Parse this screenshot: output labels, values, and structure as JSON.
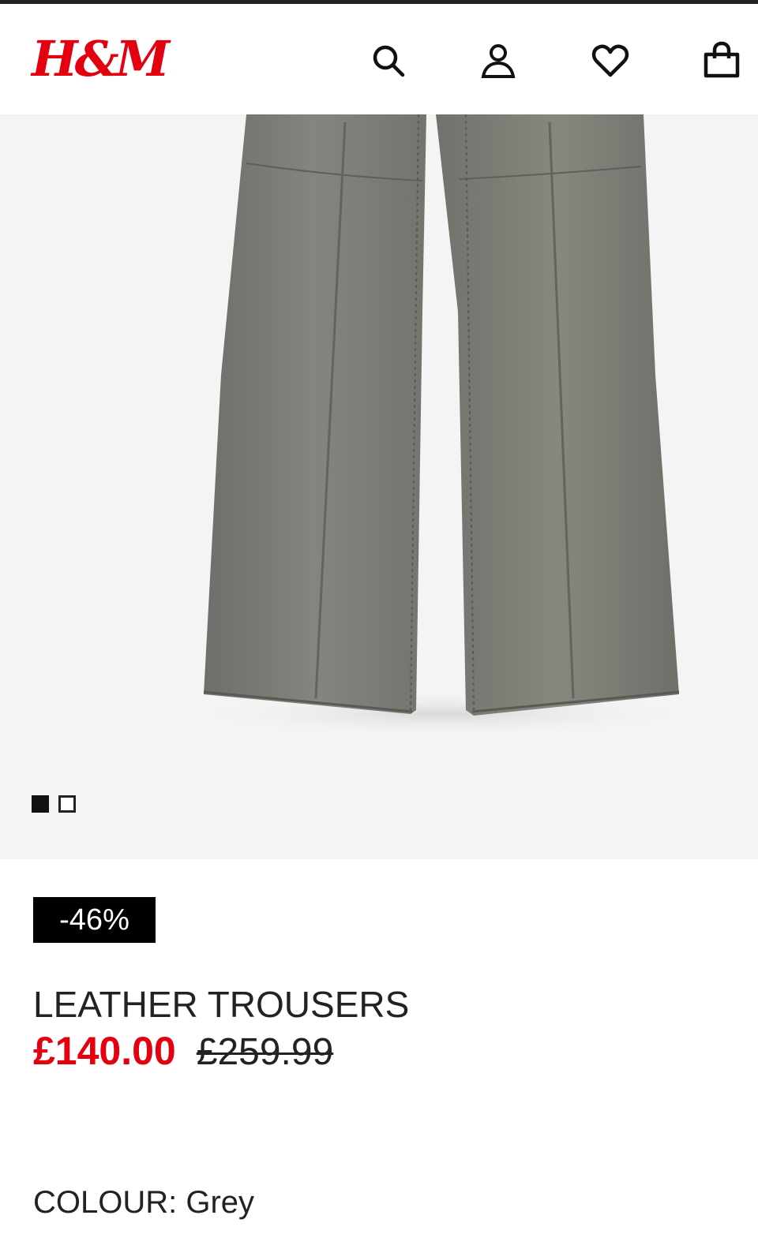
{
  "header": {
    "logo_text": "H&M",
    "icons": [
      "search-icon",
      "account-icon",
      "heart-icon",
      "bag-icon"
    ]
  },
  "gallery": {
    "image_subject": "grey leather trousers",
    "image_count": 2,
    "active_index": 0
  },
  "product": {
    "discount_badge": "-46%",
    "name": "LEATHER TROUSERS",
    "price_current": "£140.00",
    "price_original": "£259.99",
    "colour_label": "COLOUR:",
    "colour_value": "Grey"
  },
  "colors": {
    "brand_red": "#e50010",
    "text": "#222222",
    "badge_bg": "#000000",
    "gallery_bg": "#f4f4f4",
    "trouser_grey": "#7c7c78"
  }
}
